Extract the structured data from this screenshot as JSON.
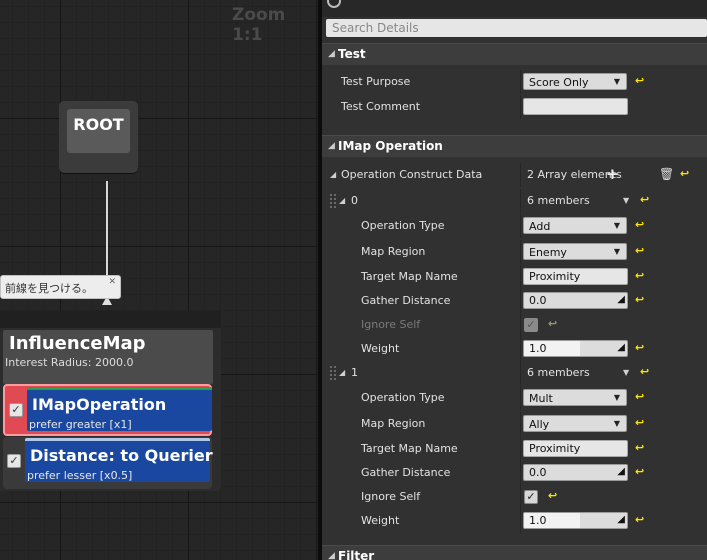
{
  "graph": {
    "zoom_label": "Zoom 1:1",
    "root_label": "ROOT",
    "comment_text": "前線を見つける。",
    "node": {
      "title": "InfluenceMap",
      "subtitle": "Interest Radius: 2000.0",
      "decorators": [
        {
          "title": "IMapOperation",
          "subtitle": "prefer greater [x1]",
          "checked": true
        },
        {
          "title": "Distance: to Querier",
          "subtitle": "prefer lesser [x0.5]",
          "checked": true
        }
      ]
    }
  },
  "details": {
    "search_placeholder": "Search Details",
    "categories": {
      "test": "Test",
      "imap": "IMap Operation",
      "filter": "Filter"
    },
    "test": {
      "purpose_label": "Test Purpose",
      "purpose_value": "Score Only",
      "comment_label": "Test Comment",
      "comment_value": ""
    },
    "operation_data": {
      "label": "Operation Construct Data",
      "value": "2 Array elements"
    },
    "elements": [
      {
        "index": "0",
        "members": "6 members",
        "op_type_label": "Operation Type",
        "op_type": "Add",
        "region_label": "Map Region",
        "region": "Enemy",
        "target_label": "Target Map Name",
        "target": "Proximity",
        "gather_label": "Gather Distance",
        "gather": "0.0",
        "ignore_label": "Ignore Self",
        "ignore_checked": true,
        "weight_label": "Weight",
        "weight": "1.0"
      },
      {
        "index": "1",
        "members": "6 members",
        "op_type_label": "Operation Type",
        "op_type": "Mult",
        "region_label": "Map Region",
        "region": "Ally",
        "target_label": "Target Map Name",
        "target": "Proximity",
        "gather_label": "Gather Distance",
        "gather": "0.0",
        "ignore_label": "Ignore Self",
        "ignore_checked": true,
        "weight_label": "Weight",
        "weight": "1.0"
      }
    ]
  },
  "icons": {
    "reset": "↩",
    "check": "✓",
    "dropdown": "▼",
    "collapse": "◢",
    "add": "+",
    "trash": "🗑",
    "spin": "◢"
  },
  "colors": {
    "accent_reset": "#ffe600",
    "decorator_selected": "#e04a52",
    "decorator_body": "#1a48a0"
  }
}
